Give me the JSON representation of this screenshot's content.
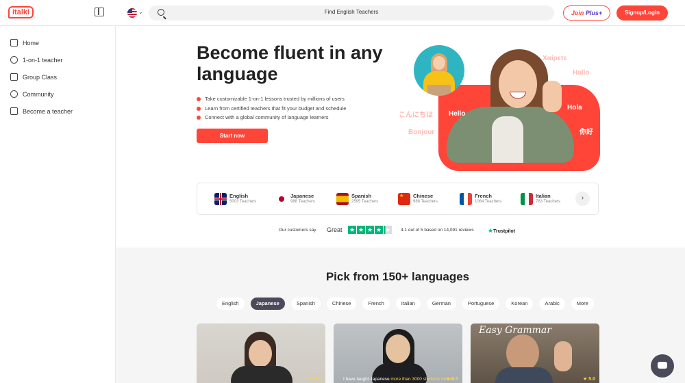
{
  "brand": {
    "logo_text": "italki",
    "accent": "#ff4438"
  },
  "header": {
    "search_placeholder": "Find English Teachers",
    "join_plus_label": "Join",
    "join_plus_accent": "Plus+",
    "signup_label": "Signup/Login",
    "language_flag": "us-flag-icon"
  },
  "sidebar": {
    "items": [
      {
        "label": "Home",
        "icon": "home-icon"
      },
      {
        "label": "1-on-1 teacher",
        "icon": "teacher-icon"
      },
      {
        "label": "Group Class",
        "icon": "group-class-icon"
      },
      {
        "label": "Community",
        "icon": "community-icon"
      },
      {
        "label": "Become a teacher",
        "icon": "graduation-cap-icon"
      }
    ]
  },
  "hero": {
    "title": "Become fluent in any language",
    "bullets": [
      "Take customizable 1-on-1 lessons trusted by millions of users",
      "Learn from certified teachers that fit your budget and schedule",
      "Connect with a global community of language learners"
    ],
    "cta_label": "Start now",
    "greetings": [
      "Χαίρετε",
      "Hallo",
      "こんにちは",
      "Hello",
      "Hola",
      "你好",
      "Bonjour"
    ]
  },
  "languages": [
    {
      "name": "English",
      "count": "5003 Teachers",
      "flag": "uk-flag-icon"
    },
    {
      "name": "Japanese",
      "count": "988 Teachers",
      "flag": "japan-flag-icon"
    },
    {
      "name": "Spanish",
      "count": "2595 Teachers",
      "flag": "spain-flag-icon"
    },
    {
      "name": "Chinese",
      "count": "988 Teachers",
      "flag": "china-flag-icon"
    },
    {
      "name": "French",
      "count": "1064 Teachers",
      "flag": "france-flag-icon"
    },
    {
      "name": "Italian",
      "count": "783 Teachers",
      "flag": "italy-flag-icon"
    }
  ],
  "trustpilot": {
    "customers_say": "Our customers say",
    "rating_word": "Great",
    "stars": 4.1,
    "score_text": "4.1 out of 5 based on 14,091 reviews",
    "brand": "Trustpilot"
  },
  "pick": {
    "title": "Pick from 150+ languages",
    "chips": [
      "English",
      "Japanese",
      "Spanish",
      "Chinese",
      "French",
      "Italian",
      "German",
      "Portuguese",
      "Korean",
      "Arabic",
      "More"
    ],
    "active_chip": "Japanese"
  },
  "cards": [
    {
      "rating": "★ 5.0"
    },
    {
      "caption_start": "I have taught Japanese ",
      "caption_highlight": "more than 3000 students before",
      "rating": "★ 5.0"
    },
    {
      "title": "Easy Grammar",
      "rating": "★ 5.0"
    }
  ]
}
